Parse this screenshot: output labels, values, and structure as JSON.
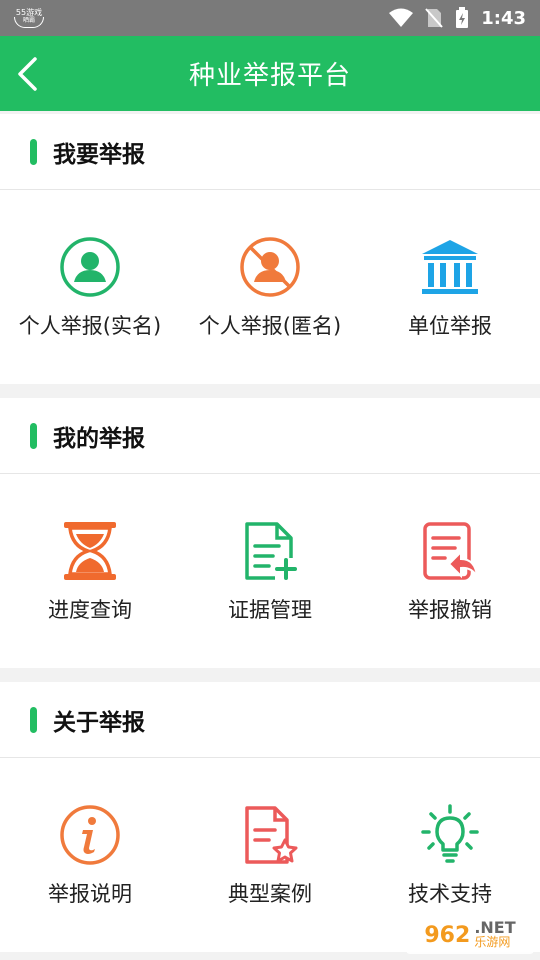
{
  "status_bar": {
    "logo_top": "55游戏",
    "logo_bottom": "晒霸",
    "time": "1:43"
  },
  "app_bar": {
    "title": "种业举报平台"
  },
  "sections": [
    {
      "title": "我要举报",
      "items": [
        {
          "label": "个人举报(实名)",
          "icon": "person-verified-icon",
          "color": "#22b46a"
        },
        {
          "label": "个人举报(匿名)",
          "icon": "person-anonymous-icon",
          "color": "#f07a3c"
        },
        {
          "label": "单位举报",
          "icon": "building-icon",
          "color": "#1ea4e6"
        }
      ]
    },
    {
      "title": "我的举报",
      "items": [
        {
          "label": "进度查询",
          "icon": "hourglass-icon",
          "color": "#f06a2e"
        },
        {
          "label": "证据管理",
          "icon": "document-add-icon",
          "color": "#22b46a"
        },
        {
          "label": "举报撤销",
          "icon": "document-revoke-icon",
          "color": "#ec5a5a"
        }
      ]
    },
    {
      "title": "关于举报",
      "items": [
        {
          "label": "举报说明",
          "icon": "info-icon",
          "color": "#f07a3c"
        },
        {
          "label": "典型案例",
          "icon": "document-star-icon",
          "color": "#ec5a5a"
        },
        {
          "label": "技术支持",
          "icon": "lightbulb-icon",
          "color": "#22b46a"
        }
      ]
    }
  ],
  "watermark": {
    "number": "962",
    "suffix": ".NET",
    "site": "乐游网"
  }
}
